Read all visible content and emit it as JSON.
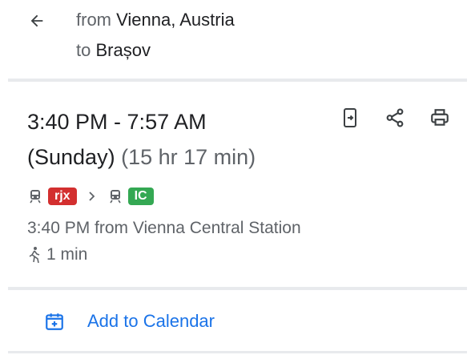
{
  "route": {
    "from_prefix": "from",
    "from_place": "Vienna, Austria",
    "to_prefix": "to",
    "to_place": "Brașov"
  },
  "trip": {
    "time_range": "3:40 PM - 7:57 AM",
    "day": "(Sunday)",
    "duration": "(15 hr 17 min)",
    "legs": [
      {
        "mode": "train-icon",
        "label": "rjx",
        "color": "#d32f2f"
      },
      {
        "mode": "train-icon",
        "label": "IC",
        "color": "#34a853"
      }
    ],
    "departure": "3:40 PM from Vienna Central Station",
    "walk": "1 min"
  },
  "actions": {
    "send_to_phone": "send-to-phone-icon",
    "share": "share-icon",
    "print": "print-icon"
  },
  "calendar": {
    "label": "Add to Calendar"
  },
  "colors": {
    "accent": "#1a73e8",
    "muted": "#5f6368",
    "divider": "#e8eaed"
  }
}
